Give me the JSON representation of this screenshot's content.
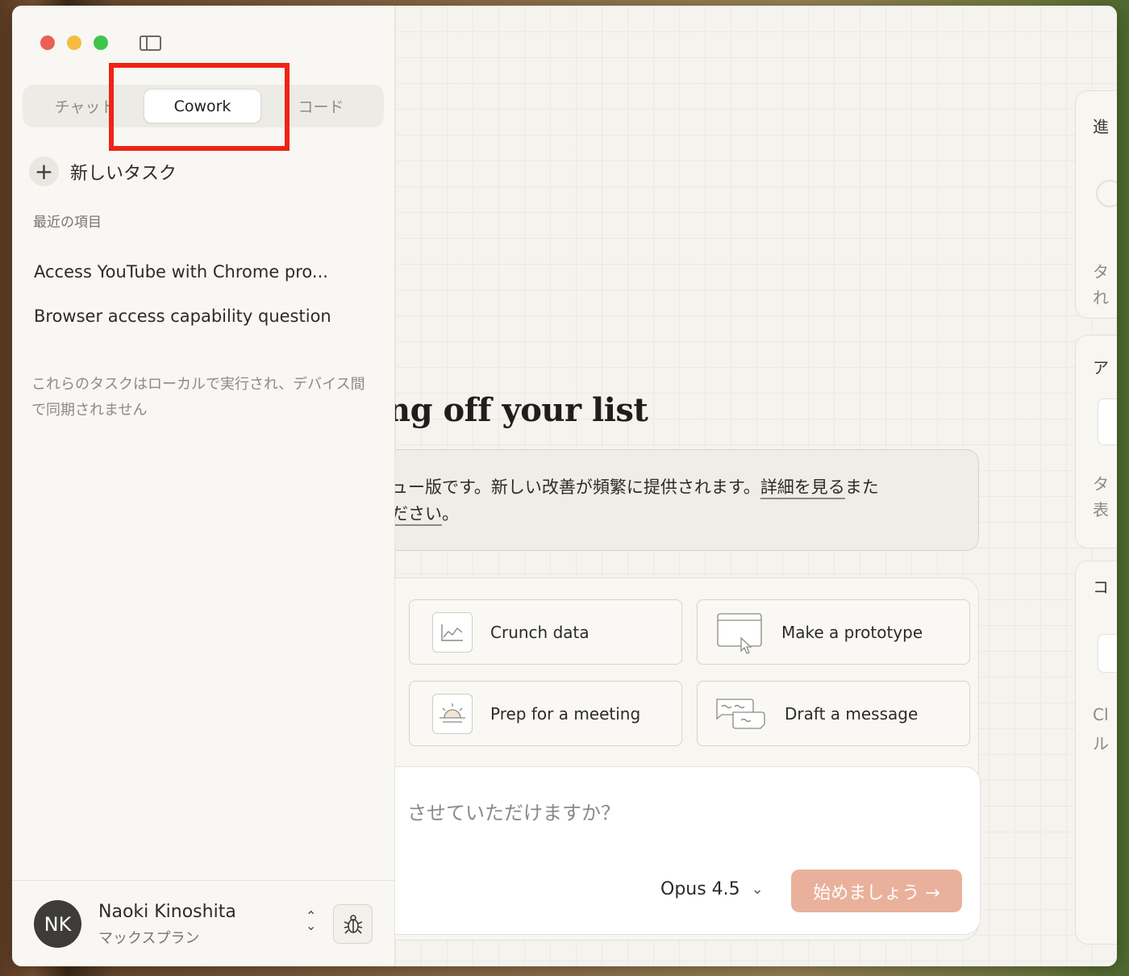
{
  "sidebar": {
    "mode_tabs": {
      "chat": "チャット",
      "cowork": "Cowork",
      "code": "コード"
    },
    "new_task_label": "新しいタスク",
    "recent_heading": "最近の項目",
    "recent_items": [
      "Access YouTube with Chrome pro...",
      "Browser access capability question"
    ],
    "local_note": "これらのタスクはローカルで実行され、デバイス間で同期されません",
    "user": {
      "initials": "NK",
      "name": "Naoki Kinoshita",
      "plan": "マックスプラン"
    }
  },
  "main": {
    "hero_title": "ng off your list",
    "notice": {
      "text_before": "ュー版です。新しい改善が頻繁に提供されます。",
      "link1": "詳細を見る",
      "text_middle": "また",
      "link2": "ださい",
      "text_after": "。"
    },
    "suggestions": [
      {
        "label": "Crunch data",
        "icon": "chart-icon"
      },
      {
        "label": "Make a prototype",
        "icon": "browser-window-icon"
      },
      {
        "label": "Prep for a meeting",
        "icon": "sunrise-icon"
      },
      {
        "label": "Draft a message",
        "icon": "chat-bubbles-icon"
      }
    ],
    "prompt_placeholder": "させていただけますか？",
    "model": "Opus 4.5",
    "start_button": "始めましょう →"
  },
  "right_panel": {
    "progress_title": "進",
    "progress_text": [
      "タ",
      "れ"
    ],
    "artifacts_title": "ア",
    "artifacts_text": [
      "タ",
      "表"
    ],
    "context_title": "コ",
    "context_text": [
      "Cl",
      "ル"
    ]
  },
  "colors": {
    "highlight": "#ee2415",
    "start_button": "#e9b19b",
    "traffic_red": "#ec5f56",
    "traffic_yellow": "#f4bd3f",
    "traffic_green": "#3ec64c"
  }
}
